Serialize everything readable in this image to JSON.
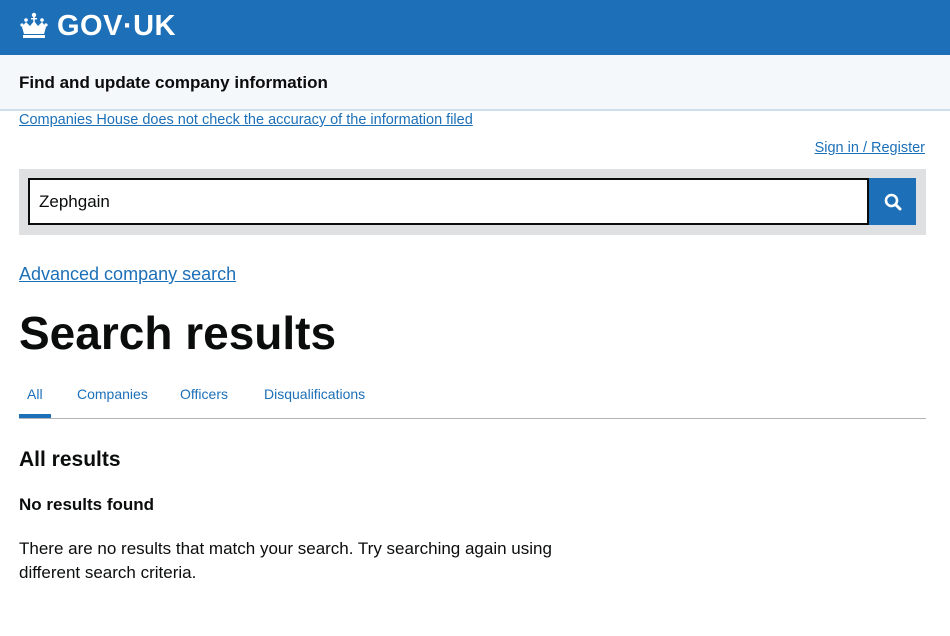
{
  "header": {
    "logo_text": "GOV·UK",
    "logo_icon": "crown-icon"
  },
  "service": {
    "name": "Find and update company information"
  },
  "notice": {
    "accuracy_link": "Companies House does not check the accuracy of the information filed"
  },
  "account": {
    "signin_link": "Sign in / Register"
  },
  "search": {
    "value": "Zephgain",
    "button_icon": "search-icon"
  },
  "advanced_search_link": "Advanced company search",
  "page_title": "Search results",
  "tabs": [
    {
      "label": "All",
      "active": true
    },
    {
      "label": "Companies",
      "active": false
    },
    {
      "label": "Officers",
      "active": false
    },
    {
      "label": "Disqualifications",
      "active": false
    }
  ],
  "results": {
    "heading": "All results",
    "empty_heading": "No results found",
    "empty_message": "There are no results that match your search. Try searching again using different search criteria."
  },
  "colors": {
    "brand_blue": "#1d70b8",
    "text": "#0b0c0c",
    "service_bar": "#f4f8fb",
    "search_panel": "#dee0e2"
  }
}
